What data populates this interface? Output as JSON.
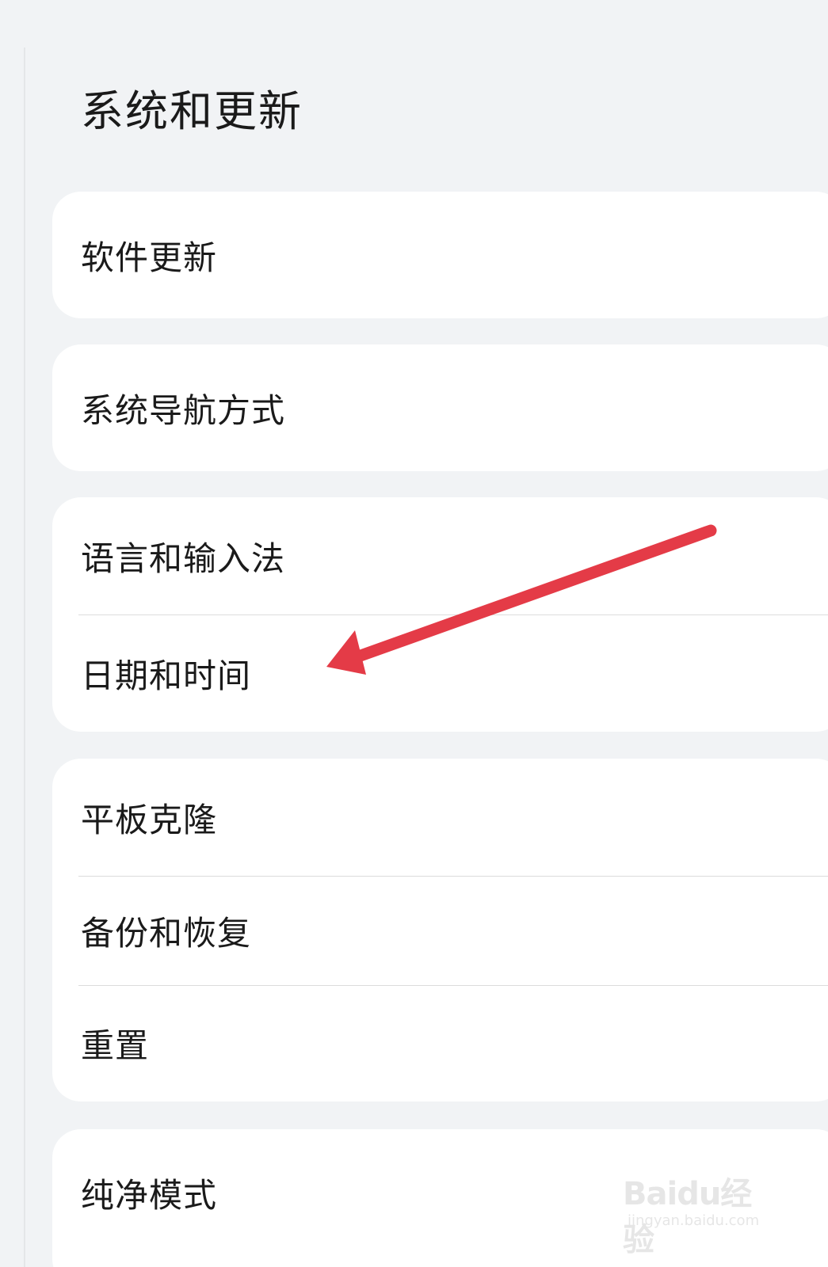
{
  "page": {
    "title": "系统和更新"
  },
  "groups": [
    {
      "items": [
        {
          "label": "软件更新"
        }
      ]
    },
    {
      "items": [
        {
          "label": "系统导航方式"
        }
      ]
    },
    {
      "items": [
        {
          "label": "语言和输入法"
        },
        {
          "label": "日期和时间"
        }
      ]
    },
    {
      "items": [
        {
          "label": "平板克隆"
        },
        {
          "label": "备份和恢复"
        },
        {
          "label": "重置"
        }
      ]
    },
    {
      "items": [
        {
          "label": "纯净模式"
        }
      ]
    }
  ],
  "annotation": {
    "arrow_color": "#e43b47",
    "points_to": "日期和时间"
  },
  "watermark": {
    "brand": "Baidu经验",
    "url": "jingyan.baidu.com"
  },
  "colors": {
    "background": "#f1f3f5",
    "card": "#ffffff",
    "text": "#1a1a1a",
    "divider": "#dcdcdc"
  }
}
